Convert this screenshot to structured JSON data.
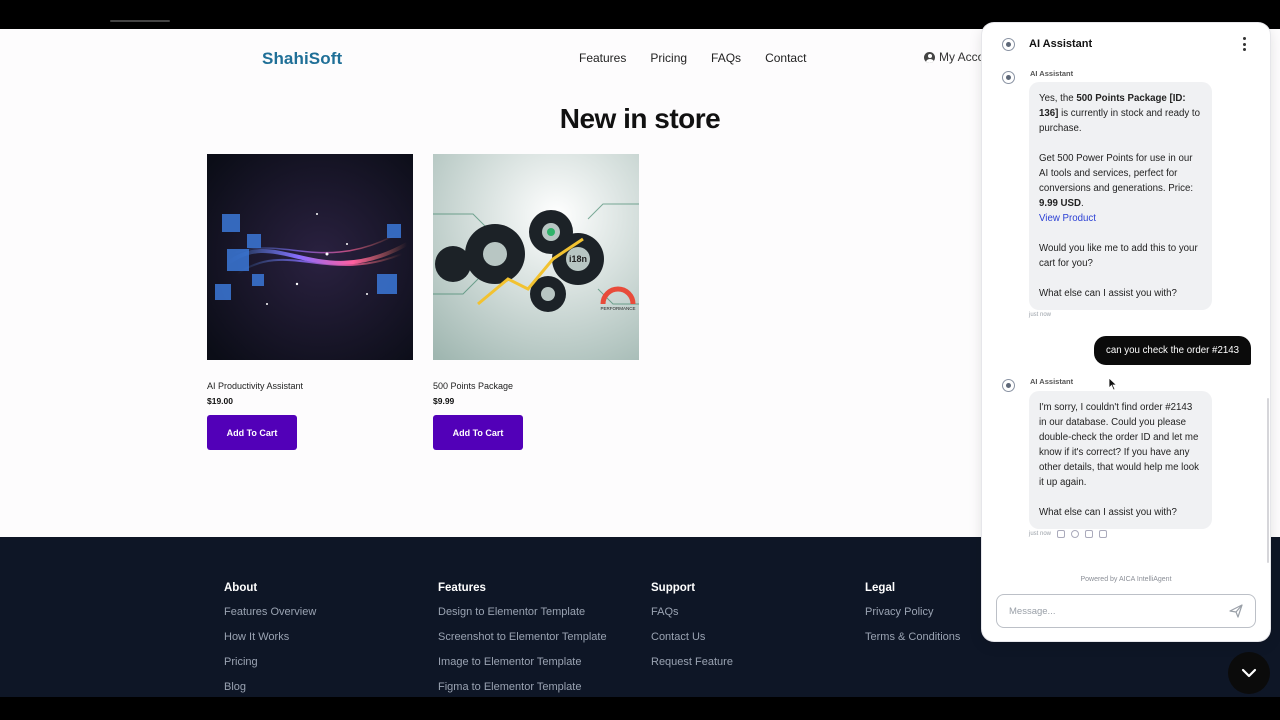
{
  "site": {
    "logo": "ShahiSoft",
    "nav": [
      "Features",
      "Pricing",
      "FAQs",
      "Contact"
    ],
    "account_label": "My Acco",
    "store_title": "New in store"
  },
  "products": [
    {
      "name": "AI Productivity Assistant",
      "price": "$19.00",
      "button": "Add To Cart"
    },
    {
      "name": "500 Points Package",
      "price": "$9.99",
      "button": "Add To Cart"
    }
  ],
  "footer": {
    "columns": [
      {
        "title": "About",
        "links": [
          "Features Overview",
          "How It Works",
          "Pricing",
          "Blog"
        ]
      },
      {
        "title": "Features",
        "links": [
          "Design to Elementor Template",
          "Screenshot to Elementor Template",
          "Image to Elementor Template",
          "Figma to Elementor Template"
        ]
      },
      {
        "title": "Support",
        "links": [
          "FAQs",
          "Contact Us",
          "Request Feature"
        ]
      },
      {
        "title": "Legal",
        "links": [
          "Privacy Policy",
          "Terms & Conditions"
        ]
      }
    ]
  },
  "chat": {
    "title": "AI Assistant",
    "sender_bot": "AI Assistant",
    "msg1": {
      "p1_pre": "Yes, the ",
      "p1_bold": "500 Points Package [ID: 136]",
      "p1_post": " is currently in stock and ready to purchase.",
      "p2": "Get 500 Power Points for use in our AI tools and services, perfect for conversions and generations.",
      "price_label": "Price: ",
      "price_value": "9.99 USD",
      "price_end": ".",
      "link": "View Product",
      "p3": "Would you like me to add this to your cart for you?",
      "p4": "What else can I assist you with?",
      "time": "just now"
    },
    "user_msg": "can you check the order #2143",
    "msg2": {
      "p1": "I'm sorry, I couldn't find order #2143 in our database. Could you please double-check the order ID and let me know if it's correct? If you have any other details, that would help me look it up again.",
      "p2": "What else can I assist you with?",
      "time": "just now"
    },
    "powered_by": "Powered by AICA IntelliAgent",
    "input_placeholder": "Message..."
  },
  "colors": {
    "brand": "#1f6f97",
    "button": "#5200b8",
    "footer_bg": "#0e1626",
    "link": "#2a3fd4"
  }
}
